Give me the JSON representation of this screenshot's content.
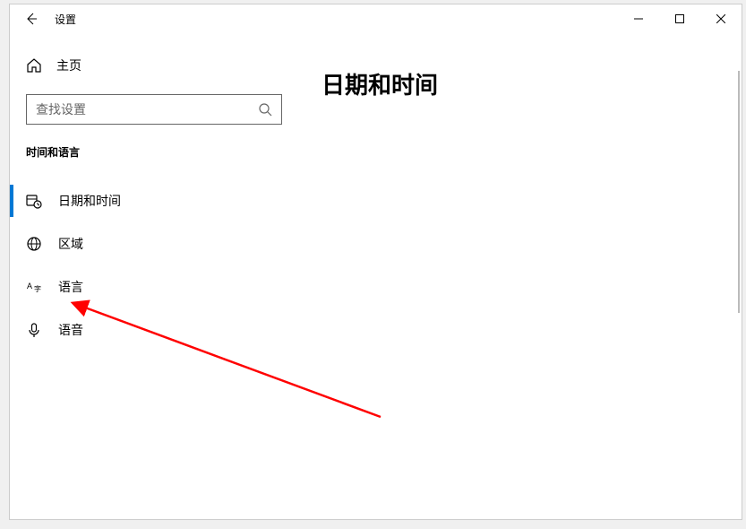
{
  "window": {
    "title": "设置"
  },
  "sidebar": {
    "home_label": "主页",
    "search_placeholder": "查找设置",
    "category_label": "时间和语言",
    "items": [
      {
        "label": "日期和时间"
      },
      {
        "label": "区域"
      },
      {
        "label": "语言"
      },
      {
        "label": "语音"
      }
    ]
  },
  "content": {
    "title": "日期和时间"
  }
}
